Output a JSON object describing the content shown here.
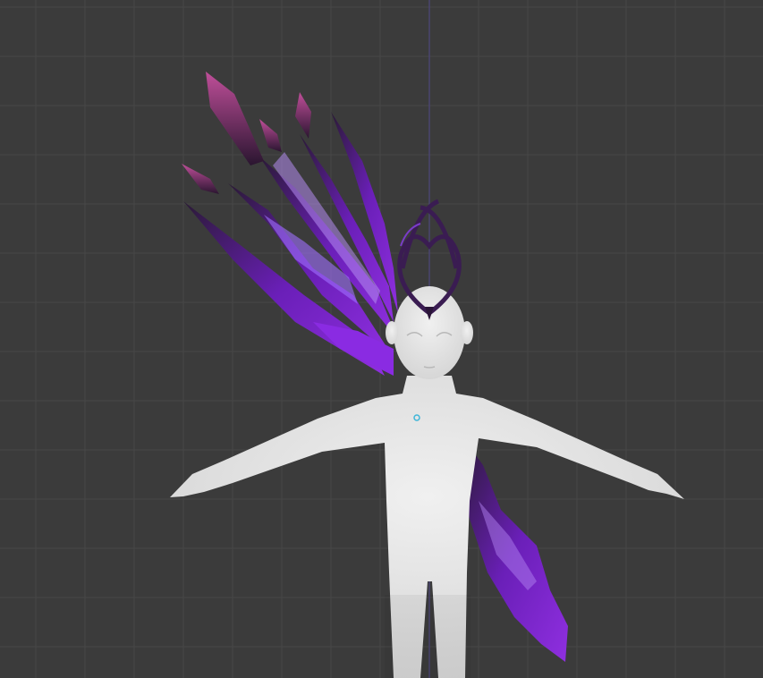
{
  "viewport": {
    "background_color": "#3b3b3b",
    "grid_color": "#474747",
    "axis_line_color": "#4a4470"
  },
  "model": {
    "body_color": "#e6e6e6",
    "wing_color": "#7a22c8",
    "crystal_color": "#a8407a",
    "dark_color": "#22182c",
    "origin_marker_color": "#3fb6d8"
  }
}
